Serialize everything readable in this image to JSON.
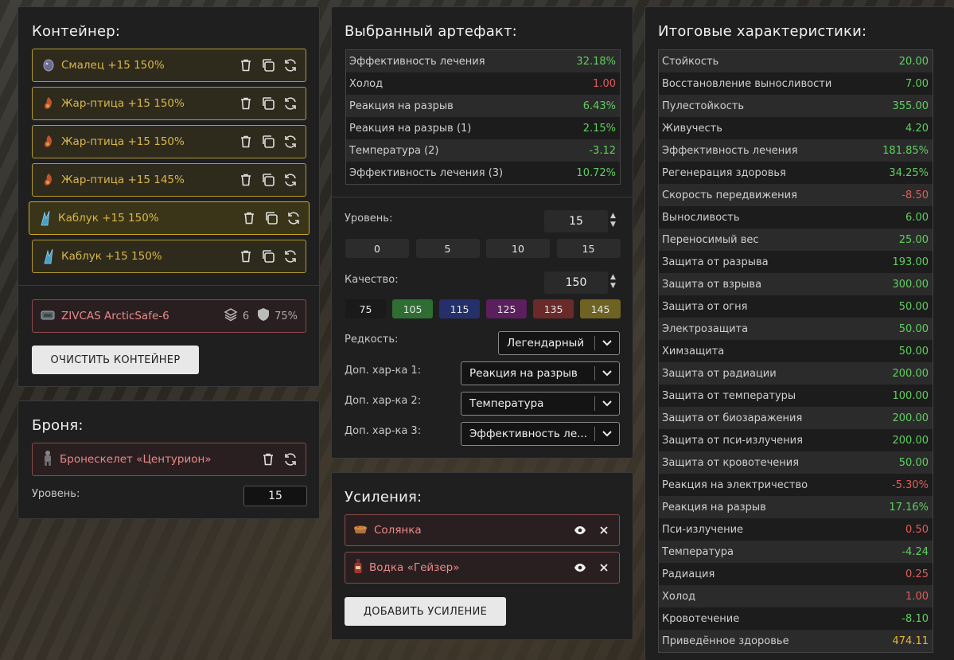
{
  "container": {
    "title": "Контейнер:",
    "artifacts": [
      {
        "label": "Смалец +15 150%",
        "icon": "smalets-artifact-icon",
        "selected": false
      },
      {
        "label": "Жар-птица +15 150%",
        "icon": "firebird-artifact-icon",
        "selected": false
      },
      {
        "label": "Жар-птица +15 150%",
        "icon": "firebird-artifact-icon",
        "selected": false
      },
      {
        "label": "Жар-птица +15 145%",
        "icon": "firebird-artifact-icon",
        "selected": false
      },
      {
        "label": "Каблук +15 150%",
        "icon": "heel-artifact-icon",
        "selected": true
      },
      {
        "label": "Каблук +15 150%",
        "icon": "heel-artifact-icon",
        "selected": false
      }
    ],
    "slot": {
      "label": "ZIVCAS ArcticSafe-6",
      "capacity": "6",
      "protection": "75%"
    },
    "clear_button": "ОЧИСТИТЬ КОНТЕЙНЕР"
  },
  "armor": {
    "title": "Броня:",
    "item": "Бронескелет «Центурион»",
    "level_label": "Уровень:",
    "level_value": "15"
  },
  "selected_artifact": {
    "title": "Выбранный артефакт:",
    "stats": [
      {
        "name": "Эффективность лечения",
        "value": "32.18%",
        "tone": "pos"
      },
      {
        "name": "Холод",
        "value": "1.00",
        "tone": "neg"
      },
      {
        "name": "Реакция на разрыв",
        "value": "6.43%",
        "tone": "pos"
      },
      {
        "name": "Реакция на разрыв (1)",
        "value": "2.15%",
        "tone": "pos"
      },
      {
        "name": "Температура (2)",
        "value": "-3.12",
        "tone": "pos"
      },
      {
        "name": "Эффективность лечения (3)",
        "value": "10.72%",
        "tone": "pos"
      }
    ],
    "level_label": "Уровень:",
    "level_value": "15",
    "level_presets": [
      "0",
      "5",
      "10",
      "15"
    ],
    "quality_label": "Качество:",
    "quality_value": "150",
    "quality_presets": [
      {
        "label": "75",
        "color": "#1a1a1a"
      },
      {
        "label": "105",
        "color": "#2f6e33"
      },
      {
        "label": "115",
        "color": "#25306b"
      },
      {
        "label": "125",
        "color": "#5a1f5c"
      },
      {
        "label": "135",
        "color": "#6b2a2a"
      },
      {
        "label": "145",
        "color": "#6e6323"
      }
    ],
    "rarity_label": "Редкость:",
    "rarity_value": "Легендарный",
    "extra1_label": "Доп. хар-ка 1:",
    "extra1_value": "Реакция на разрыв",
    "extra2_label": "Доп. хар-ка 2:",
    "extra2_value": "Температура",
    "extra3_label": "Доп. хар-ка 3:",
    "extra3_value": "Эффективность ле..."
  },
  "boosts": {
    "title": "Усиления:",
    "items": [
      {
        "label": "Солянка",
        "icon": "solyanka-icon"
      },
      {
        "label": "Водка «Гейзер»",
        "icon": "vodka-bottle-icon"
      }
    ],
    "add_button": "ДОБАВИТЬ УСИЛЕНИЕ"
  },
  "totals": {
    "title": "Итоговые характеристики:",
    "stats": [
      {
        "name": "Стойкость",
        "value": "20.00",
        "tone": "pos"
      },
      {
        "name": "Восстановление выносливости",
        "value": "7.00",
        "tone": "pos"
      },
      {
        "name": "Пулестойкость",
        "value": "355.00",
        "tone": "pos"
      },
      {
        "name": "Живучесть",
        "value": "4.20",
        "tone": "pos"
      },
      {
        "name": "Эффективность лечения",
        "value": "181.85%",
        "tone": "pos"
      },
      {
        "name": "Регенерация здоровья",
        "value": "34.25%",
        "tone": "pos"
      },
      {
        "name": "Скорость передвижения",
        "value": "-8.50",
        "tone": "neg"
      },
      {
        "name": "Выносливость",
        "value": "6.00",
        "tone": "pos"
      },
      {
        "name": "Переносимый вес",
        "value": "25.00",
        "tone": "pos"
      },
      {
        "name": "Защита от разрыва",
        "value": "193.00",
        "tone": "pos"
      },
      {
        "name": "Защита от взрыва",
        "value": "300.00",
        "tone": "pos"
      },
      {
        "name": "Защита от огня",
        "value": "50.00",
        "tone": "pos"
      },
      {
        "name": "Электрозащита",
        "value": "50.00",
        "tone": "pos"
      },
      {
        "name": "Химзащита",
        "value": "50.00",
        "tone": "pos"
      },
      {
        "name": "Защита от радиации",
        "value": "200.00",
        "tone": "pos"
      },
      {
        "name": "Защита от температуры",
        "value": "100.00",
        "tone": "pos"
      },
      {
        "name": "Защита от биозаражения",
        "value": "200.00",
        "tone": "pos"
      },
      {
        "name": "Защита от пси-излучения",
        "value": "200.00",
        "tone": "pos"
      },
      {
        "name": "Защита от кровотечения",
        "value": "50.00",
        "tone": "pos"
      },
      {
        "name": "Реакция на электричество",
        "value": "-5.30%",
        "tone": "neg"
      },
      {
        "name": "Реакция на разрыв",
        "value": "17.16%",
        "tone": "pos"
      },
      {
        "name": "Пси-излучение",
        "value": "0.50",
        "tone": "neg"
      },
      {
        "name": "Температура",
        "value": "-4.24",
        "tone": "pos"
      },
      {
        "name": "Радиация",
        "value": "0.25",
        "tone": "neg"
      },
      {
        "name": "Холод",
        "value": "1.00",
        "tone": "neg"
      },
      {
        "name": "Кровотечение",
        "value": "-8.10",
        "tone": "pos"
      },
      {
        "name": "Приведённое здоровье",
        "value": "474.11",
        "tone": "gold"
      }
    ]
  }
}
